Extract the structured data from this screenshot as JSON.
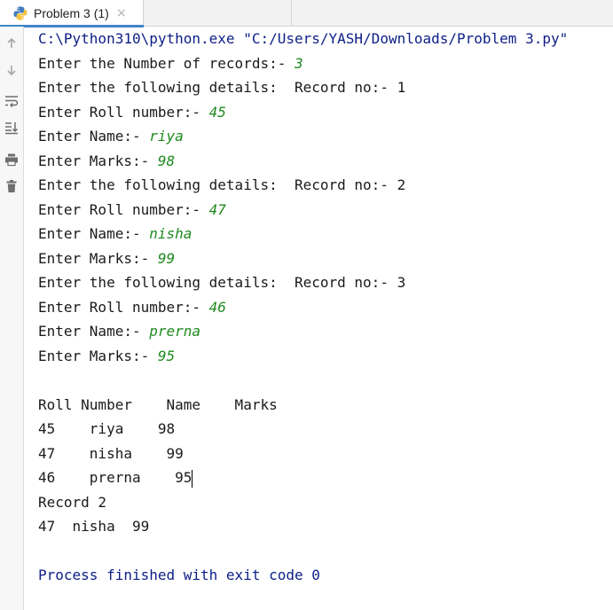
{
  "tab": {
    "label": "Problem 3 (1)",
    "close": "×"
  },
  "gutter": {
    "icons": [
      "arrow-up-icon",
      "arrow-down-icon",
      "soft-wrap-icon",
      "scroll-to-end-icon",
      "print-icon",
      "trash-icon"
    ]
  },
  "console": {
    "command": "C:\\Python310\\python.exe \"C:/Users/YASH/Downloads/Problem 3.py\"",
    "lines": [
      {
        "prompt": "Enter the Number of records:- ",
        "input": "3"
      },
      {
        "prompt": "Enter the following details:  Record no:- 1",
        "input": ""
      },
      {
        "prompt": "Enter Roll number:- ",
        "input": "45"
      },
      {
        "prompt": "Enter Name:- ",
        "input": "riya"
      },
      {
        "prompt": "Enter Marks:- ",
        "input": "98"
      },
      {
        "prompt": "Enter the following details:  Record no:- 2",
        "input": ""
      },
      {
        "prompt": "Enter Roll number:- ",
        "input": "47"
      },
      {
        "prompt": "Enter Name:- ",
        "input": "nisha"
      },
      {
        "prompt": "Enter Marks:- ",
        "input": "99"
      },
      {
        "prompt": "Enter the following details:  Record no:- 3",
        "input": ""
      },
      {
        "prompt": "Enter Roll number:- ",
        "input": "46"
      },
      {
        "prompt": "Enter Name:- ",
        "input": "prerna"
      },
      {
        "prompt": "Enter Marks:- ",
        "input": "95"
      }
    ],
    "table_header": "Roll Number    Name    Marks",
    "table_rows": [
      "45    riya    98",
      "47    nisha    99",
      "46    prerna    95"
    ],
    "record_title": "Record 2",
    "record_line": "47  nisha  99",
    "exit_message": "Process finished with exit code 0"
  }
}
